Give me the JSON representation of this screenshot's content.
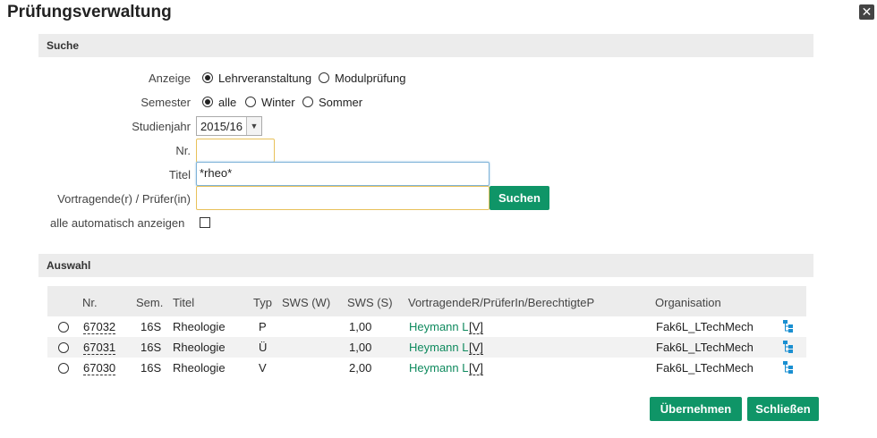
{
  "header": {
    "title": "Prüfungsverwaltung",
    "close_icon": "close-icon"
  },
  "search": {
    "section_title": "Suche",
    "anzeige_label": "Anzeige",
    "anzeige_options": [
      "Lehrveranstaltung",
      "Modulprüfung"
    ],
    "anzeige_selected": "Lehrveranstaltung",
    "semester_label": "Semester",
    "semester_options": [
      "alle",
      "Winter",
      "Sommer"
    ],
    "semester_selected": "alle",
    "studienjahr_label": "Studienjahr",
    "studienjahr_value": "2015/16",
    "nr_label": "Nr.",
    "nr_value": "",
    "titel_label": "Titel",
    "titel_value": "*rheo*",
    "vortragende_label": "Vortragende(r) / Prüfer(in)",
    "vortragende_value": "",
    "search_button": "Suchen",
    "auto_label": "alle automatisch anzeigen",
    "auto_checked": false
  },
  "results": {
    "section_title": "Auswahl",
    "columns": [
      "Nr.",
      "Sem.",
      "Titel",
      "Typ",
      "SWS (W)",
      "SWS (S)",
      "VortragendeR/PrüferIn/BerechtigteP",
      "Organisation"
    ],
    "rows": [
      {
        "nr": "67032",
        "sem": "16S",
        "titel": "Rheologie",
        "typ": "P",
        "sws_w": "",
        "sws_s": "1,00",
        "person": "Heymann L",
        "flag": "[V]",
        "org": "Fak6L_LTechMech"
      },
      {
        "nr": "67031",
        "sem": "16S",
        "titel": "Rheologie",
        "typ": "Ü",
        "sws_w": "",
        "sws_s": "1,00",
        "person": "Heymann L",
        "flag": "[V]",
        "org": "Fak6L_LTechMech"
      },
      {
        "nr": "67030",
        "sem": "16S",
        "titel": "Rheologie",
        "typ": "V",
        "sws_w": "",
        "sws_s": "2,00",
        "person": "Heymann L",
        "flag": "[V]",
        "org": "Fak6L_LTechMech"
      }
    ]
  },
  "footer": {
    "apply_button": "Übernehmen",
    "close_button": "Schließen"
  },
  "colors": {
    "accent": "#0f9567",
    "link": "#0f8a5e",
    "section_bg": "#ececec"
  }
}
